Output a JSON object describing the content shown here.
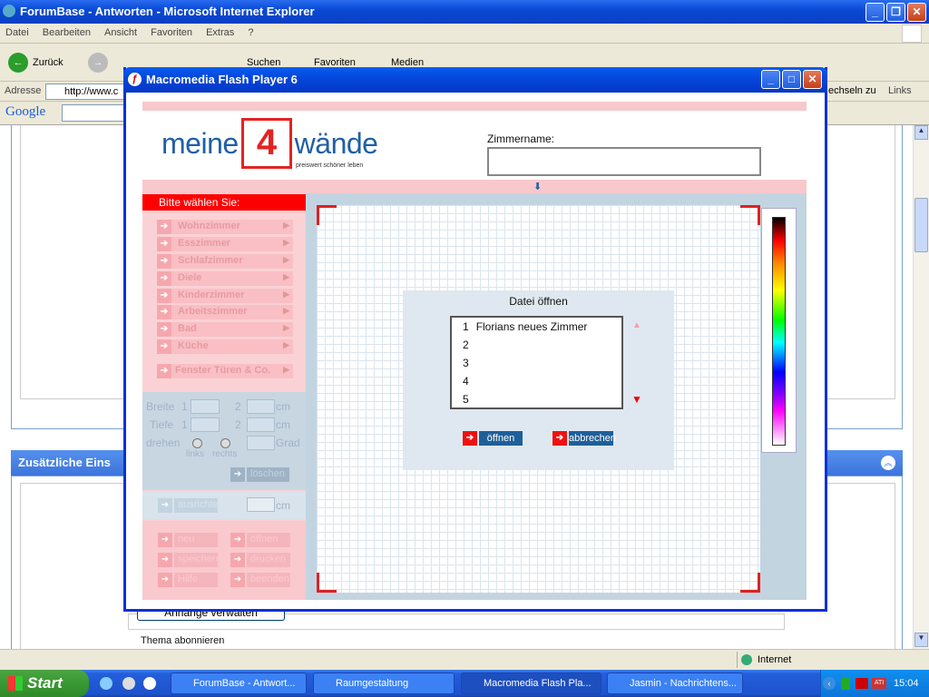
{
  "ie": {
    "title": "ForumBase - Antworten - Microsoft Internet Explorer",
    "menu": [
      "Datei",
      "Bearbeiten",
      "Ansicht",
      "Favoriten",
      "Extras",
      "?"
    ],
    "back_label": "Zurück",
    "search_label": "Suchen",
    "favorites_label": "Favoriten",
    "media_label": "Medien",
    "address_label": "Adresse",
    "address_value": "http://www.c",
    "switch_label": "echseln zu",
    "links_label": "Links",
    "google_label": "Google",
    "status_zone": "Internet"
  },
  "background_page": {
    "extra_settings_header": "Zusätzliche Eins",
    "attachments_button": "Anhänge verwalten",
    "subscribe_label": "Thema abonnieren"
  },
  "flash": {
    "window_title": "Macromedia Flash Player 6",
    "logo": {
      "text_left": "meine",
      "text_num": "4",
      "text_right": "wände",
      "tagline": "preiswert schöner leben"
    },
    "room_name_label": "Zimmername:",
    "room_name_value": "",
    "choose_header": "Bitte wählen Sie:",
    "rooms": [
      "Wohnzimmer",
      "Esszimmer",
      "Schlafzimmer",
      "Diele",
      "Kinderzimmer",
      "Arbeitszimmer",
      "Bad",
      "Küche"
    ],
    "windows_doors": "Fenster Türen & Co.",
    "dims": {
      "width_label": "Breite",
      "depth_label": "Tiefe",
      "rotate_label": "drehen",
      "one": "1",
      "two": "2",
      "unit_cm": "cm",
      "unit_deg": "Grad",
      "left_label": "links",
      "right_label": "rechts",
      "delete_label": "löschen"
    },
    "align_label": "ausrichten",
    "align_unit": "cm",
    "actions": [
      "neu",
      "öffnen",
      "speichern",
      "drucken",
      "Hilfe",
      "beenden"
    ],
    "colors": {
      "accent_red": "#ee1111",
      "brand_blue": "#1f5fa6",
      "pink": "#f8c8cc"
    }
  },
  "dialog": {
    "title": "Datei öffnen",
    "rows": [
      {
        "num": "1",
        "name": "Florians neues Zimmer"
      },
      {
        "num": "2",
        "name": ""
      },
      {
        "num": "3",
        "name": ""
      },
      {
        "num": "4",
        "name": ""
      },
      {
        "num": "5",
        "name": ""
      }
    ],
    "open_label": "öffnen",
    "cancel_label": "abbrechen"
  },
  "taskbar": {
    "start_label": "Start",
    "tasks": [
      "ForumBase - Antwort...",
      "Raumgestaltung",
      "Macromedia Flash Pla...",
      "Jasmin - Nachrichtens..."
    ],
    "clock": "15:04"
  }
}
